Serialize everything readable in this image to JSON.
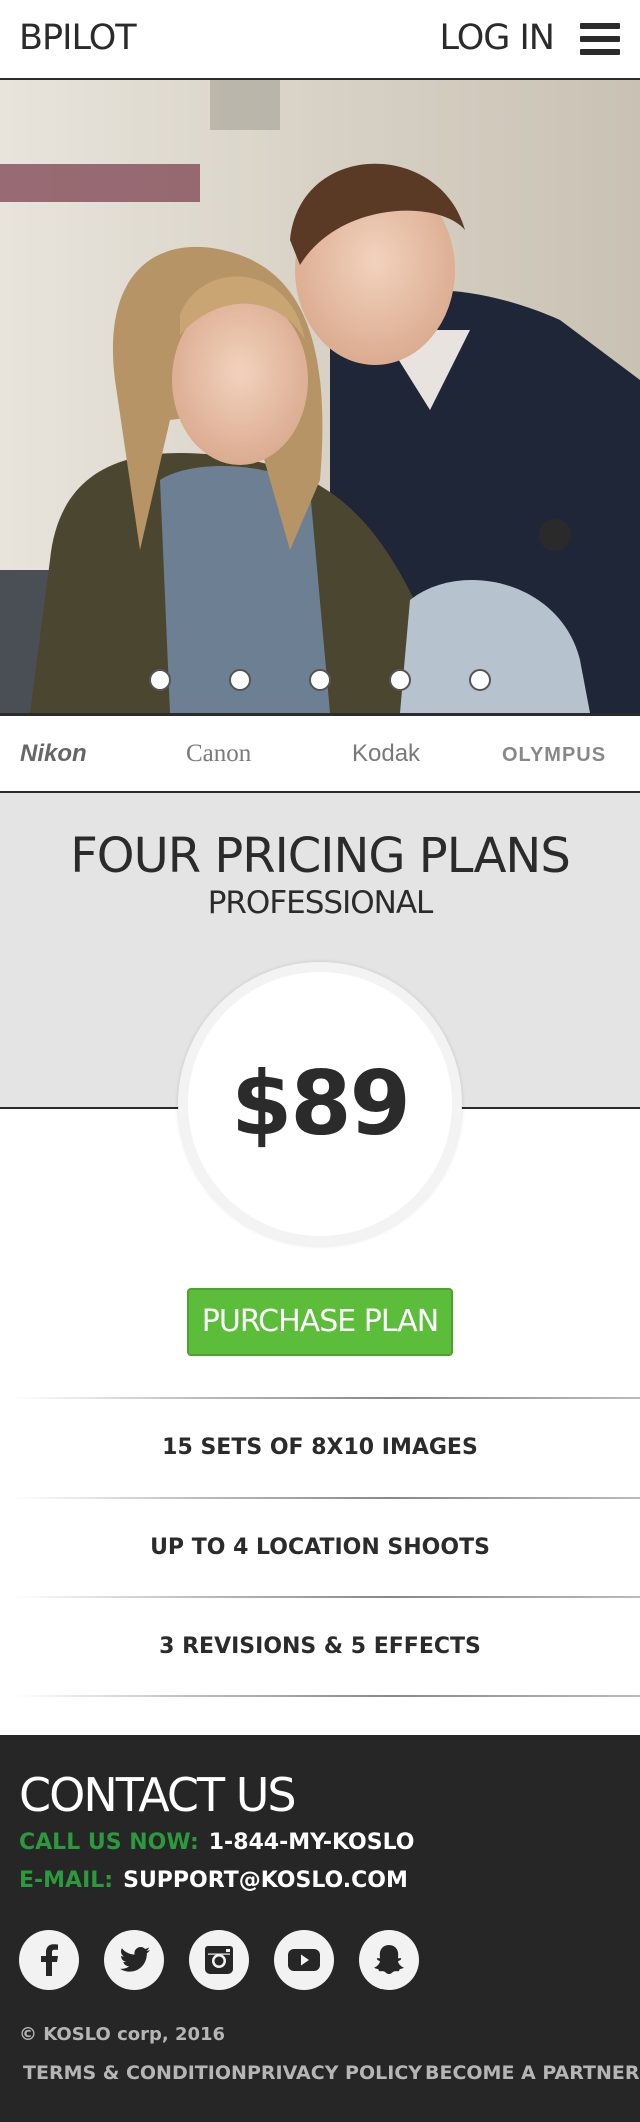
{
  "header": {
    "logo": "BPILOT",
    "login_label": "LOG IN",
    "menu_icon": "hamburger-menu-icon"
  },
  "hero": {
    "slide_count": 5,
    "active_slide": 1
  },
  "brands": [
    "Nikon",
    "Canon",
    "Kodak",
    "OLYMPUS"
  ],
  "pricing": {
    "title": "FOUR PRICING PLANS",
    "subtitle": "PROFESSIONAL",
    "price": "$89",
    "purchase_label": "PURCHASE PLAN",
    "features": [
      "15 SETS OF 8X10 IMAGES",
      "UP TO 4 LOCATION SHOOTS",
      "3 REVISIONS & 5 EFFECTS"
    ],
    "accent_color": "#5cbd3a"
  },
  "footer": {
    "title": "CONTACT US",
    "phone_label": "CALL US NOW:",
    "phone_value": "1-844-MY-KOSLO",
    "email_label": "E-MAIL:",
    "email_value": "SUPPORT@KOSLO.COM",
    "label_color": "#2b9a3c",
    "social_icons": [
      "facebook-icon",
      "twitter-icon",
      "instagram-icon",
      "youtube-icon",
      "snapchat-icon"
    ],
    "copyright": "© KOSLO corp, 2016",
    "links": [
      "TERMS & CONDITION",
      "PRIVACY POLICY",
      "BECOME A PARTNER"
    ]
  }
}
